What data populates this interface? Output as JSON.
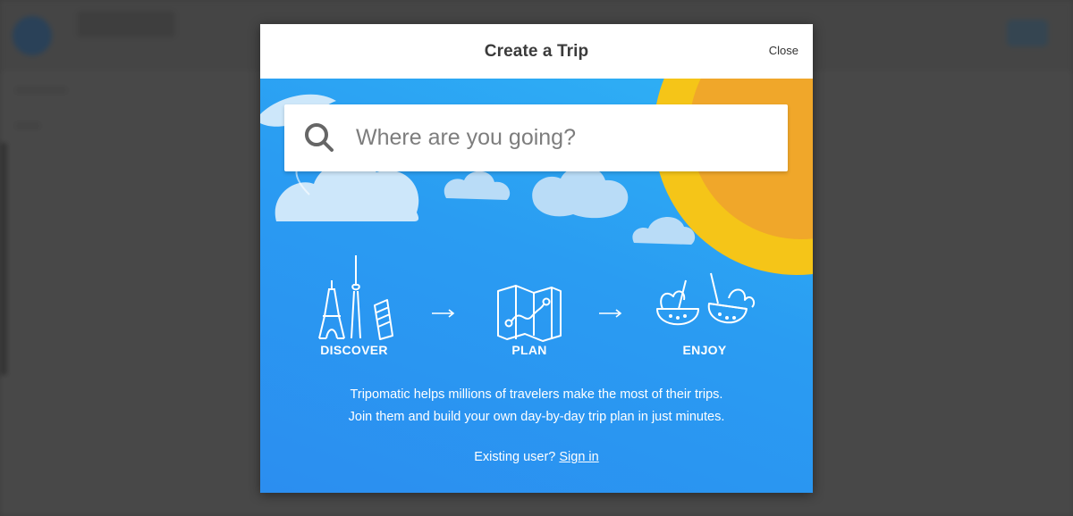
{
  "modal": {
    "title": "Create a Trip",
    "close_label": "Close"
  },
  "search": {
    "placeholder": "Where are you going?",
    "value": ""
  },
  "steps": [
    {
      "label": "DISCOVER",
      "icon": "landmarks-icon"
    },
    {
      "label": "PLAN",
      "icon": "map-icon"
    },
    {
      "label": "ENJOY",
      "icon": "coconut-drinks-icon"
    }
  ],
  "description": {
    "line1": "Tripomatic helps millions of travelers make the most of their trips.",
    "line2": "Join them and build your own day-by-day trip plan in just minutes."
  },
  "signin": {
    "prompt": "Existing user?",
    "link_label": "Sign in"
  },
  "colors": {
    "hero_blue": "#2a9cf2",
    "sun_yellow": "#f5c518",
    "sun_orange": "#f0a72a",
    "cloud": "#cde7fa"
  }
}
